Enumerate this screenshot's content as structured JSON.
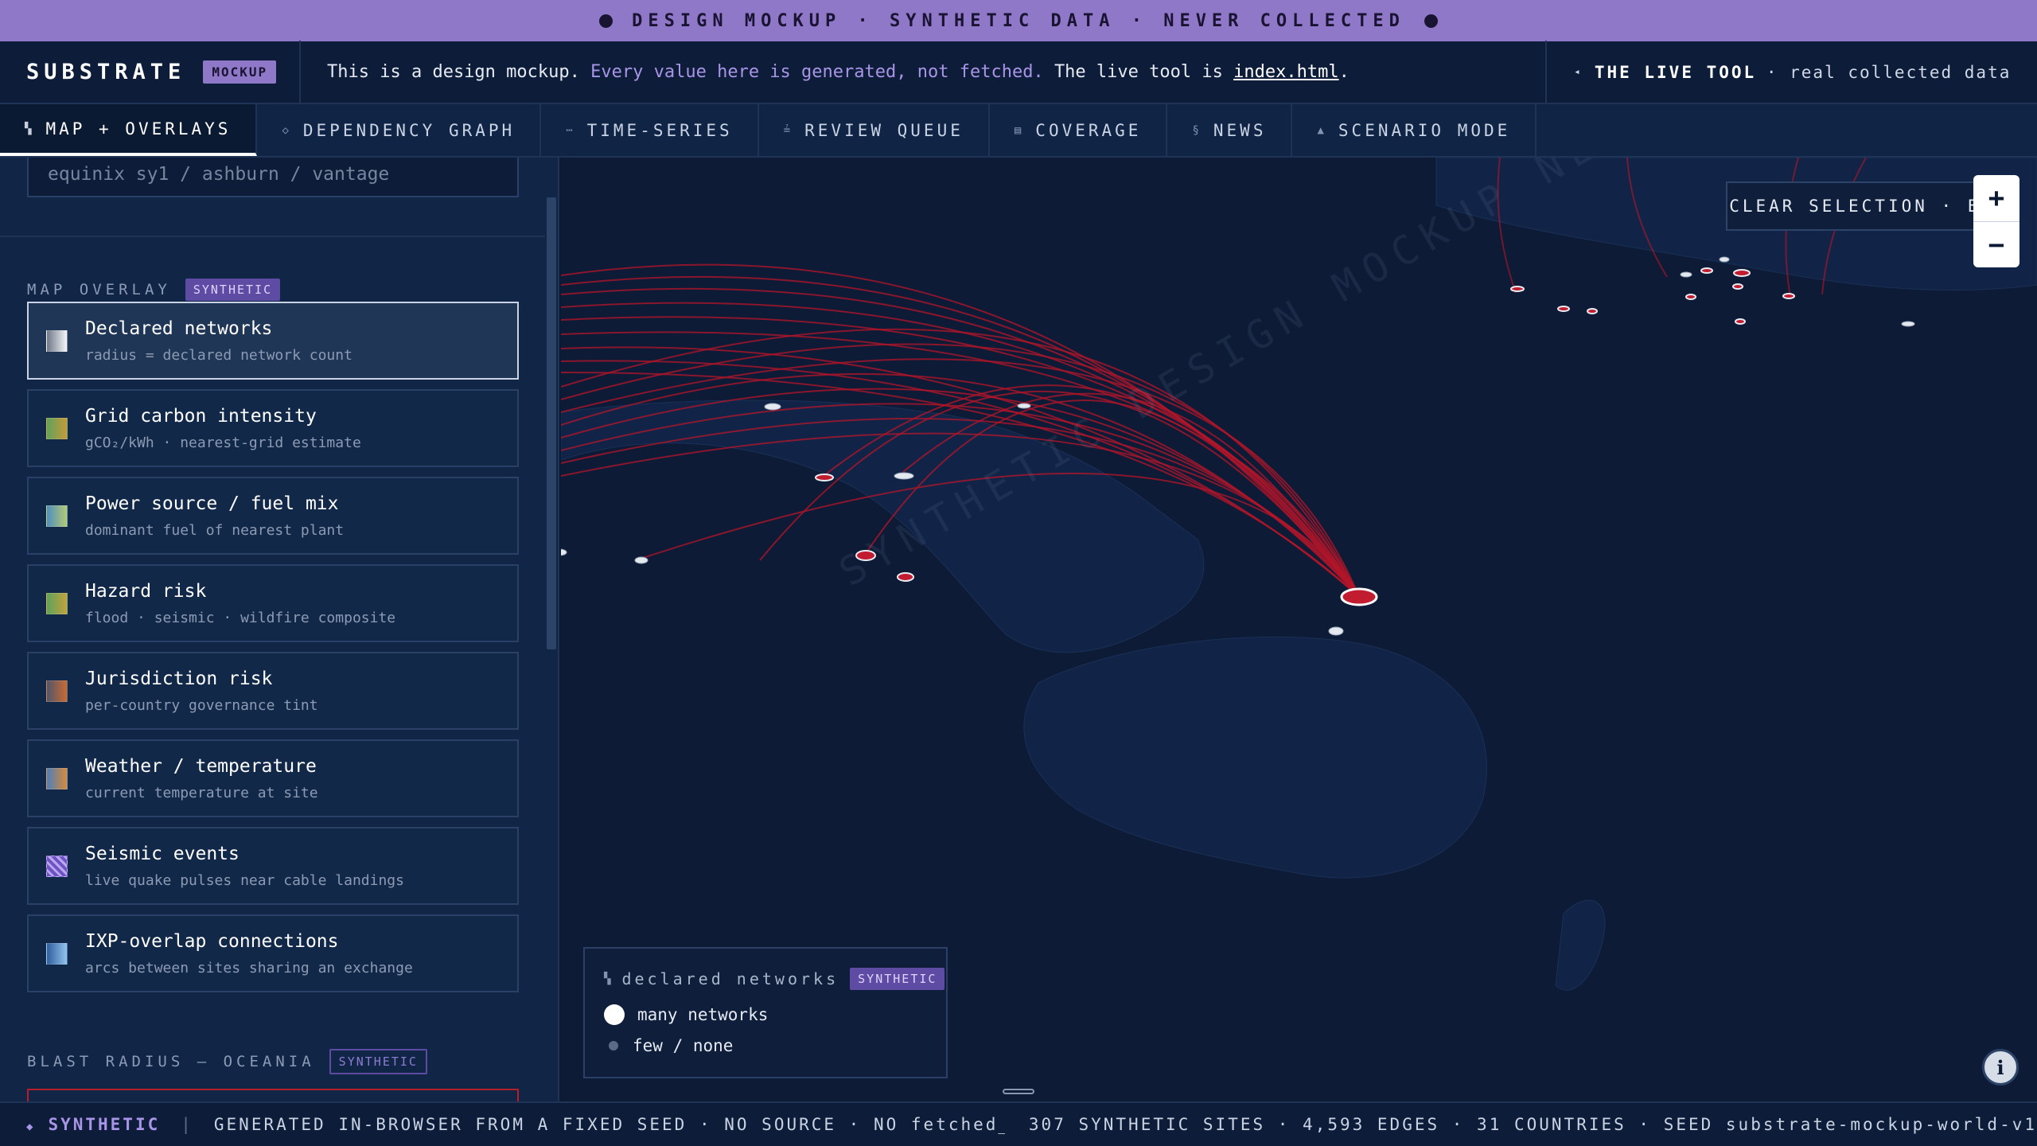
{
  "banner": {
    "text": "DESIGN MOCKUP · SYNTHETIC DATA · NEVER COLLECTED"
  },
  "header": {
    "brand": "SUBSTRATE",
    "badge": "MOCKUP",
    "notice_prefix": "This is a design mockup.",
    "notice_highlight": "Every value here is generated, not fetched.",
    "notice_middle": "The live tool is",
    "notice_link": "index.html",
    "notice_end": ".",
    "live_tool_label": "THE LIVE TOOL",
    "live_tool_sub": "· real collected data"
  },
  "tabs": [
    {
      "icon": "grid-icon",
      "glyph": "▚",
      "label": "MAP + OVERLAYS",
      "active": true
    },
    {
      "icon": "diamond-icon",
      "glyph": "◇",
      "label": "DEPENDENCY GRAPH"
    },
    {
      "icon": "dots-icon",
      "glyph": "⋯",
      "label": "TIME-SERIES"
    },
    {
      "icon": "list-icon",
      "glyph": "≟",
      "label": "REVIEW QUEUE"
    },
    {
      "icon": "table-icon",
      "glyph": "▤",
      "label": "COVERAGE"
    },
    {
      "icon": "section-icon",
      "glyph": "§",
      "label": "NEWS"
    },
    {
      "icon": "triangle-icon",
      "glyph": "▲",
      "label": "SCENARIO MODE"
    }
  ],
  "sidebar": {
    "search_placeholder": "equinix sy1 / ashburn / vantage",
    "overlay_heading": "MAP OVERLAY",
    "overlay_badge": "SYNTHETIC",
    "overlays": [
      {
        "title": "Declared networks",
        "sub": "radius = declared network count",
        "colors": [
          "#6f7787",
          "#f4f6fa"
        ],
        "selected": true
      },
      {
        "title": "Grid carbon intensity",
        "sub": "gCO₂/kWh · nearest-grid estimate",
        "colors": [
          "#5fa25a",
          "#c79a3a"
        ]
      },
      {
        "title": "Power source / fuel mix",
        "sub": "dominant fuel of nearest plant",
        "colors": [
          "#4f8fbf",
          "#b4c973"
        ]
      },
      {
        "title": "Hazard risk",
        "sub": "flood · seismic · wildfire composite",
        "colors": [
          "#5fa25a",
          "#c2a23f"
        ]
      },
      {
        "title": "Jurisdiction risk",
        "sub": "per-country governance tint",
        "colors": [
          "#51566b",
          "#c96b33"
        ]
      },
      {
        "title": "Weather / temperature",
        "sub": "current temperature at site",
        "colors": [
          "#4f7fb8",
          "#d68a3a"
        ]
      },
      {
        "title": "Seismic events",
        "sub": "live quake pulses near cable landings",
        "colors": [
          "#6f52c4",
          "#b8a8f0"
        ],
        "striped": true
      },
      {
        "title": "IXP-overlap connections",
        "sub": "arcs between sites sharing an exchange",
        "colors": [
          "#2f5f9e",
          "#93c3ec"
        ]
      }
    ],
    "blast_heading": "BLAST RADIUS — OCEANIA",
    "blast_badge": "SYNTHETIC"
  },
  "map": {
    "watermark": "SYNTHETIC DESIGN MOCKUP NEVER COLLECTED",
    "clear_label": "CLEAR SELECTION · ESC",
    "zoom_in": "+",
    "zoom_out": "−",
    "info": "i",
    "arc_color": "#b3152a",
    "legend": {
      "title": "declared networks",
      "badge": "SYNTHETIC",
      "many": "many networks",
      "few": "few / none"
    }
  },
  "status": {
    "tag": "SYNTHETIC",
    "message": "GENERATED IN-BROWSER FROM A FIXED SEED · NO SOURCE · NO fetched_at · NEVER WR…",
    "summary": "307 SYNTHETIC SITES · 4,593 EDGES · 31 COUNTRIES · SEED substrate-mockup-world-v1"
  }
}
